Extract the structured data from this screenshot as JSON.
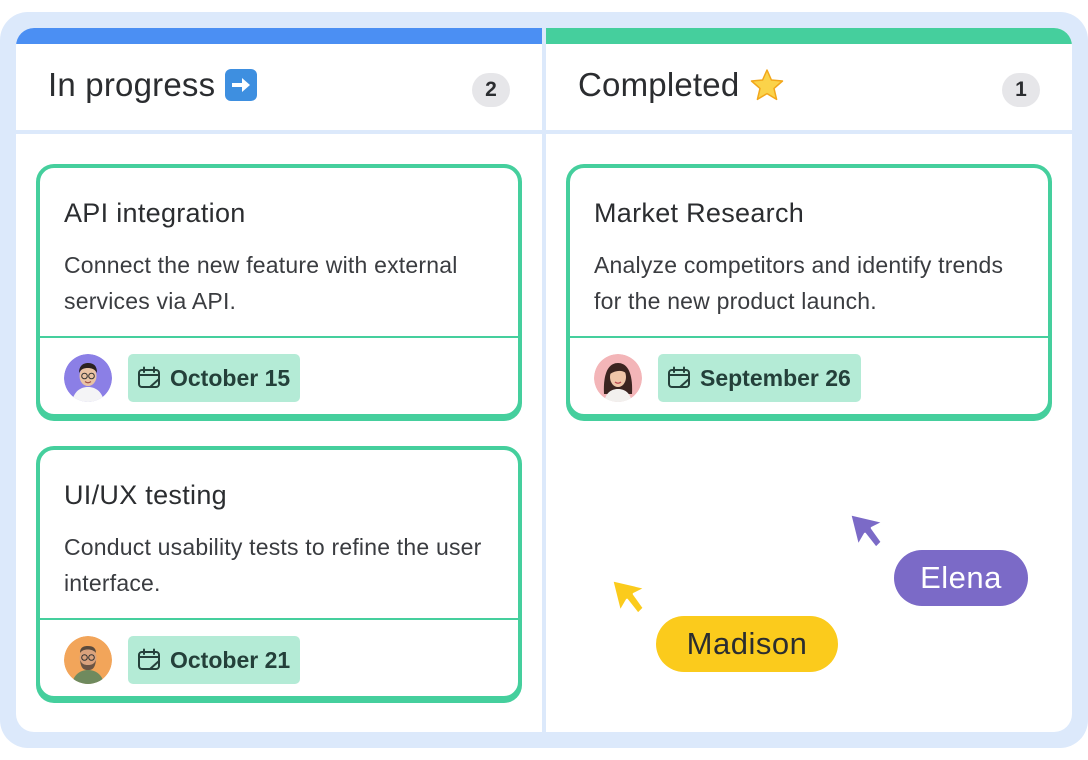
{
  "columns": [
    {
      "title": "In progress",
      "title_icon": "arrow-right-emoji-icon",
      "count": "2",
      "accent_color": "#4b8ff3",
      "cards": [
        {
          "title": "API integration",
          "description": "Connect the new feature with external services via API.",
          "avatar": "user-avatar-asian-man-glasses",
          "date": "October 15"
        },
        {
          "title": "UI/UX testing",
          "description": "Conduct usability tests to refine the user interface.",
          "avatar": "user-avatar-bearded-man",
          "date": "October 21"
        }
      ]
    },
    {
      "title": "Completed",
      "title_icon": "star-emoji-icon",
      "count": "1",
      "accent_color": "#45cf9d",
      "cards": [
        {
          "title": "Market Research",
          "description": "Analyze competitors and identify trends for the new product launch.",
          "avatar": "user-avatar-woman-dark-hair",
          "date": "September 26"
        }
      ]
    }
  ],
  "cursors": [
    {
      "name": "Elena",
      "color": "#7b6ac7"
    },
    {
      "name": "Madison",
      "color": "#fbcb1c"
    }
  ],
  "colors": {
    "card_border": "#45cf9d",
    "date_chip_bg": "#b4ebd6",
    "frame_bg": "#dce9fb"
  }
}
